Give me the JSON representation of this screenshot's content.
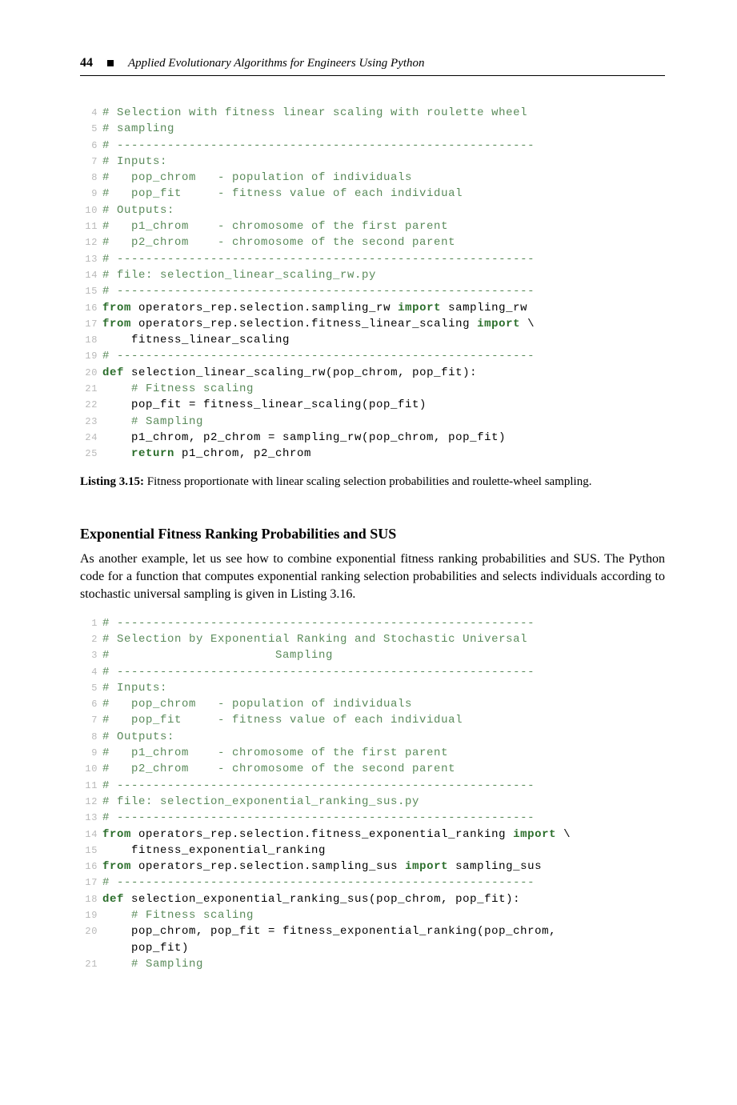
{
  "header": {
    "page_num": "44",
    "book_title": "Applied Evolutionary Algorithms for Engineers Using Python"
  },
  "listing1": {
    "lines": [
      {
        "n": "4",
        "cls": "comment",
        "text": "# Selection with fitness linear scaling with roulette wheel"
      },
      {
        "n": "5",
        "cls": "comment",
        "text": "# sampling"
      },
      {
        "n": "6",
        "cls": "comment",
        "text": "# ----------------------------------------------------------"
      },
      {
        "n": "7",
        "cls": "comment",
        "text": "# Inputs:"
      },
      {
        "n": "8",
        "cls": "comment",
        "text": "#   pop_chrom   - population of individuals"
      },
      {
        "n": "9",
        "cls": "comment",
        "text": "#   pop_fit     - fitness value of each individual"
      },
      {
        "n": "10",
        "cls": "comment",
        "text": "# Outputs:"
      },
      {
        "n": "11",
        "cls": "comment",
        "text": "#   p1_chrom    - chromosome of the first parent"
      },
      {
        "n": "12",
        "cls": "comment",
        "text": "#   p2_chrom    - chromosome of the second parent"
      },
      {
        "n": "13",
        "cls": "comment",
        "text": "# ----------------------------------------------------------"
      },
      {
        "n": "14",
        "cls": "comment",
        "text": "# file: selection_linear_scaling_rw.py"
      },
      {
        "n": "15",
        "cls": "comment",
        "text": "# ----------------------------------------------------------"
      },
      {
        "n": "16",
        "cls": "",
        "parts": [
          {
            "cls": "kw",
            "t": "from"
          },
          {
            "cls": "",
            "t": " operators_rep.selection.sampling_rw "
          },
          {
            "cls": "kw",
            "t": "import"
          },
          {
            "cls": "",
            "t": " sampling_rw"
          }
        ]
      },
      {
        "n": "17",
        "cls": "",
        "parts": [
          {
            "cls": "kw",
            "t": "from"
          },
          {
            "cls": "",
            "t": " operators_rep.selection.fitness_linear_scaling "
          },
          {
            "cls": "kw",
            "t": "import"
          },
          {
            "cls": "",
            "t": " \\"
          }
        ]
      },
      {
        "n": "18",
        "cls": "",
        "text": "    fitness_linear_scaling"
      },
      {
        "n": "19",
        "cls": "comment",
        "text": "# ----------------------------------------------------------"
      },
      {
        "n": "20",
        "cls": "",
        "parts": [
          {
            "cls": "kw",
            "t": "def"
          },
          {
            "cls": "",
            "t": " selection_linear_scaling_rw(pop_chrom, pop_fit):"
          }
        ]
      },
      {
        "n": "21",
        "cls": "comment",
        "text": "    # Fitness scaling"
      },
      {
        "n": "22",
        "cls": "",
        "text": "    pop_fit = fitness_linear_scaling(pop_fit)"
      },
      {
        "n": "23",
        "cls": "comment",
        "text": "    # Sampling"
      },
      {
        "n": "24",
        "cls": "",
        "text": "    p1_chrom, p2_chrom = sampling_rw(pop_chrom, pop_fit)"
      },
      {
        "n": "25",
        "cls": "",
        "parts": [
          {
            "cls": "",
            "t": "    "
          },
          {
            "cls": "kw",
            "t": "return"
          },
          {
            "cls": "",
            "t": " p1_chrom, p2_chrom"
          }
        ]
      }
    ]
  },
  "caption1": {
    "label": "Listing 3.15:",
    "text": " Fitness proportionate with linear scaling selection probabilities and roulette-wheel sampling."
  },
  "section": {
    "heading": "Exponential Fitness Ranking Probabilities and SUS",
    "paragraph": "As another example, let us see how to combine exponential fitness ranking probabilities and SUS. The Python code for a function that computes exponential ranking selection probabilities and selects individuals according to stochastic universal sampling is given in Listing 3.16."
  },
  "listing2": {
    "lines": [
      {
        "n": "1",
        "cls": "comment",
        "text": "# ----------------------------------------------------------"
      },
      {
        "n": "2",
        "cls": "comment",
        "text": "# Selection by Exponential Ranking and Stochastic Universal"
      },
      {
        "n": "3",
        "cls": "comment",
        "text": "#                       Sampling"
      },
      {
        "n": "4",
        "cls": "comment",
        "text": "# ----------------------------------------------------------"
      },
      {
        "n": "5",
        "cls": "comment",
        "text": "# Inputs:"
      },
      {
        "n": "6",
        "cls": "comment",
        "text": "#   pop_chrom   - population of individuals"
      },
      {
        "n": "7",
        "cls": "comment",
        "text": "#   pop_fit     - fitness value of each individual"
      },
      {
        "n": "8",
        "cls": "comment",
        "text": "# Outputs:"
      },
      {
        "n": "9",
        "cls": "comment",
        "text": "#   p1_chrom    - chromosome of the first parent"
      },
      {
        "n": "10",
        "cls": "comment",
        "text": "#   p2_chrom    - chromosome of the second parent"
      },
      {
        "n": "11",
        "cls": "comment",
        "text": "# ----------------------------------------------------------"
      },
      {
        "n": "12",
        "cls": "comment",
        "text": "# file: selection_exponential_ranking_sus.py"
      },
      {
        "n": "13",
        "cls": "comment",
        "text": "# ----------------------------------------------------------"
      },
      {
        "n": "14",
        "cls": "",
        "parts": [
          {
            "cls": "kw",
            "t": "from"
          },
          {
            "cls": "",
            "t": " operators_rep.selection.fitness_exponential_ranking "
          },
          {
            "cls": "kw",
            "t": "import"
          },
          {
            "cls": "",
            "t": " \\"
          }
        ]
      },
      {
        "n": "15",
        "cls": "",
        "text": "    fitness_exponential_ranking"
      },
      {
        "n": "16",
        "cls": "",
        "parts": [
          {
            "cls": "kw",
            "t": "from"
          },
          {
            "cls": "",
            "t": " operators_rep.selection.sampling_sus "
          },
          {
            "cls": "kw",
            "t": "import"
          },
          {
            "cls": "",
            "t": " sampling_sus"
          }
        ]
      },
      {
        "n": "17",
        "cls": "comment",
        "text": "# ----------------------------------------------------------"
      },
      {
        "n": "18",
        "cls": "",
        "parts": [
          {
            "cls": "kw",
            "t": "def"
          },
          {
            "cls": "",
            "t": " selection_exponential_ranking_sus(pop_chrom, pop_fit):"
          }
        ]
      },
      {
        "n": "19",
        "cls": "comment",
        "text": "    # Fitness scaling"
      },
      {
        "n": "20",
        "cls": "",
        "text": "    pop_chrom, pop_fit = fitness_exponential_ranking(pop_chrom,"
      },
      {
        "n": "",
        "cls": "",
        "text": "    pop_fit)"
      },
      {
        "n": "21",
        "cls": "comment",
        "text": "    # Sampling"
      }
    ]
  }
}
